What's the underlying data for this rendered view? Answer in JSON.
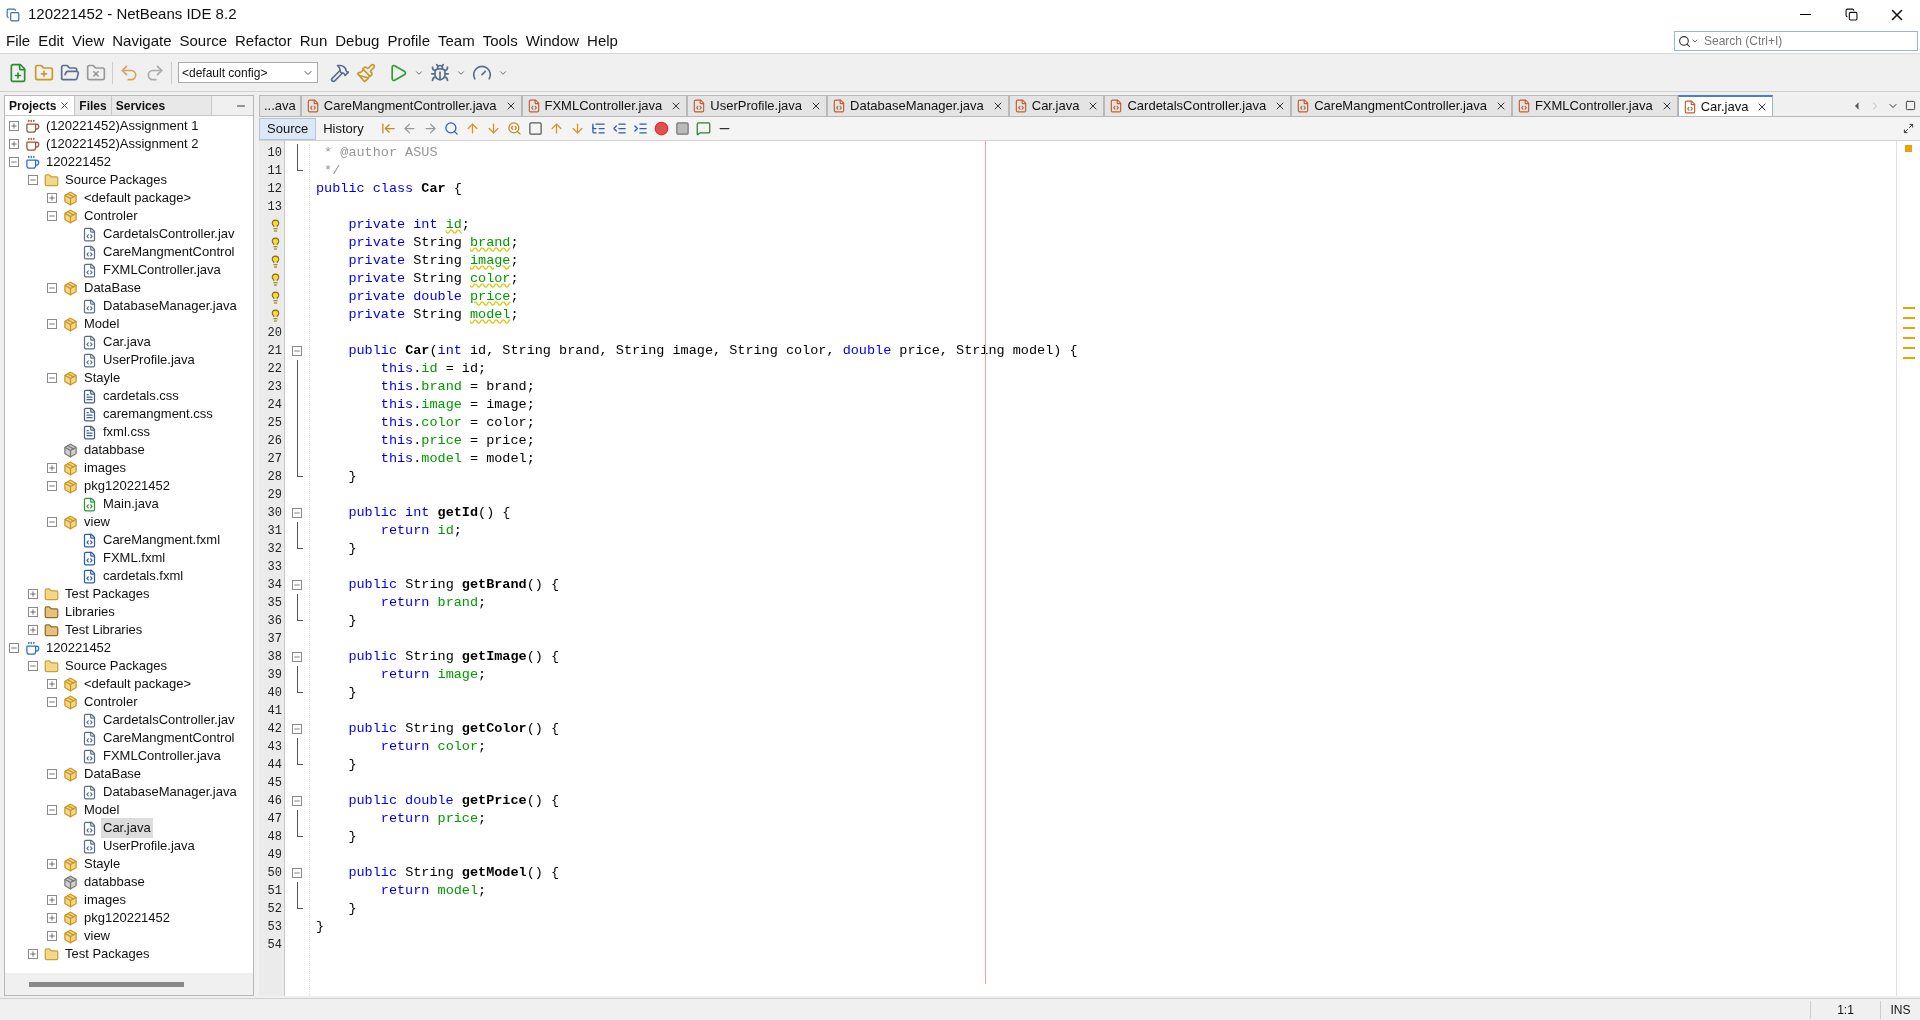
{
  "window": {
    "title": "120221452 - NetBeans IDE 8.2"
  },
  "menu": [
    "File",
    "Edit",
    "View",
    "Navigate",
    "Source",
    "Refactor",
    "Run",
    "Debug",
    "Profile",
    "Team",
    "Tools",
    "Window",
    "Help"
  ],
  "search": {
    "placeholder": "Search (Ctrl+I)"
  },
  "toolbar": {
    "config": "<default config>"
  },
  "side_panel": {
    "tabs": [
      {
        "label": "Projects",
        "selected": true
      },
      {
        "label": "Files",
        "selected": false
      },
      {
        "label": "Services",
        "selected": false
      }
    ],
    "tree": [
      {
        "label": "(120221452)Assignment 1",
        "kind": "project",
        "expanded": false,
        "selected": false
      },
      {
        "label": "(120221452)Assignment 2",
        "kind": "project",
        "expanded": false,
        "selected": false
      },
      {
        "label": "120221452",
        "kind": "fx-project",
        "expanded": true,
        "selected": false,
        "children": [
          {
            "label": "Source Packages",
            "kind": "source-folder",
            "expanded": true,
            "selected": false,
            "children": [
              {
                "label": "<default package>",
                "kind": "package",
                "expanded": false,
                "selected": false
              },
              {
                "label": "Controler",
                "kind": "package",
                "expanded": true,
                "selected": false,
                "children": [
                  {
                    "label": "CardetalsController.jav",
                    "kind": "java",
                    "selected": false
                  },
                  {
                    "label": "CareMangmentControl",
                    "kind": "java",
                    "selected": false
                  },
                  {
                    "label": "FXMLController.java",
                    "kind": "java",
                    "selected": false
                  }
                ]
              },
              {
                "label": "DataBase",
                "kind": "package",
                "expanded": true,
                "selected": false,
                "children": [
                  {
                    "label": "DatabaseManager.java",
                    "kind": "java",
                    "selected": false
                  }
                ]
              },
              {
                "label": "Model",
                "kind": "package",
                "expanded": true,
                "selected": false,
                "children": [
                  {
                    "label": "Car.java",
                    "kind": "java",
                    "selected": false
                  },
                  {
                    "label": "UserProfile.java",
                    "kind": "java",
                    "selected": false
                  }
                ]
              },
              {
                "label": "Stayle",
                "kind": "package",
                "expanded": true,
                "selected": false,
                "children": [
                  {
                    "label": "cardetals.css",
                    "kind": "css",
                    "selected": false
                  },
                  {
                    "label": "caremangment.css",
                    "kind": "css",
                    "selected": false
                  },
                  {
                    "label": "fxml.css",
                    "kind": "css",
                    "selected": false
                  }
                ]
              },
              {
                "label": "databbase",
                "kind": "empty-package",
                "selected": false
              },
              {
                "label": "images",
                "kind": "package",
                "expanded": false,
                "selected": false
              },
              {
                "label": "pkg120221452",
                "kind": "package",
                "expanded": true,
                "selected": false,
                "children": [
                  {
                    "label": "Main.java",
                    "kind": "main-java",
                    "selected": false
                  }
                ]
              },
              {
                "label": "view",
                "kind": "package",
                "expanded": true,
                "selected": false,
                "children": [
                  {
                    "label": "CareMangment.fxml",
                    "kind": "fxml",
                    "selected": false
                  },
                  {
                    "label": "FXML.fxml",
                    "kind": "fxml",
                    "selected": false
                  },
                  {
                    "label": "cardetals.fxml",
                    "kind": "fxml",
                    "selected": false
                  }
                ]
              }
            ]
          },
          {
            "label": "Test Packages",
            "kind": "source-folder",
            "expanded": false,
            "selected": false
          },
          {
            "label": "Libraries",
            "kind": "library-folder",
            "expanded": false,
            "selected": false
          },
          {
            "label": "Test Libraries",
            "kind": "library-folder",
            "expanded": false,
            "selected": false
          }
        ]
      },
      {
        "label": "120221452",
        "kind": "fx-project",
        "expanded": true,
        "selected": false,
        "children": [
          {
            "label": "Source Packages",
            "kind": "source-folder",
            "expanded": true,
            "selected": false,
            "children": [
              {
                "label": "<default package>",
                "kind": "package",
                "expanded": false,
                "selected": false
              },
              {
                "label": "Controler",
                "kind": "package",
                "expanded": true,
                "selected": false,
                "children": [
                  {
                    "label": "CardetalsController.jav",
                    "kind": "java",
                    "selected": false
                  },
                  {
                    "label": "CareMangmentControl",
                    "kind": "java",
                    "selected": false
                  },
                  {
                    "label": "FXMLController.java",
                    "kind": "java",
                    "selected": false
                  }
                ]
              },
              {
                "label": "DataBase",
                "kind": "package",
                "expanded": true,
                "selected": false,
                "children": [
                  {
                    "label": "DatabaseManager.java",
                    "kind": "java",
                    "selected": false
                  }
                ]
              },
              {
                "label": "Model",
                "kind": "package",
                "expanded": true,
                "selected": false,
                "children": [
                  {
                    "label": "Car.java",
                    "kind": "java",
                    "selected": true
                  },
                  {
                    "label": "UserProfile.java",
                    "kind": "java",
                    "selected": false
                  }
                ]
              },
              {
                "label": "Stayle",
                "kind": "package",
                "expanded": false,
                "selected": false
              },
              {
                "label": "databbase",
                "kind": "empty-package",
                "selected": false
              },
              {
                "label": "images",
                "kind": "package",
                "expanded": false,
                "selected": false
              },
              {
                "label": "pkg120221452",
                "kind": "package",
                "expanded": false,
                "selected": false
              },
              {
                "label": "view",
                "kind": "package",
                "expanded": false,
                "selected": false
              }
            ]
          },
          {
            "label": "Test Packages",
            "kind": "source-folder",
            "expanded": false,
            "selected": false
          }
        ]
      }
    ]
  },
  "editor": {
    "tabs": [
      {
        "label": "...ava",
        "selected": false
      },
      {
        "label": "CareMangmentController.java",
        "selected": false
      },
      {
        "label": "FXMLController.java",
        "selected": false
      },
      {
        "label": "UserProfile.java",
        "selected": false
      },
      {
        "label": "DatabaseManager.java",
        "selected": false
      },
      {
        "label": "Car.java",
        "selected": false
      },
      {
        "label": "CardetalsController.java",
        "selected": false
      },
      {
        "label": "CareMangmentController.java",
        "selected": false
      },
      {
        "label": "FXMLController.java",
        "selected": false
      },
      {
        "label": "Car.java",
        "selected": true
      }
    ],
    "views": [
      {
        "label": "Source",
        "selected": true
      },
      {
        "label": "History",
        "selected": false
      }
    ],
    "lines": [
      {
        "number": "10",
        "kind": "fold-body",
        "tokens": [
          {
            "kind": "comment",
            "text": " * @author ASUS"
          }
        ]
      },
      {
        "number": "11",
        "kind": "fold-end",
        "tokens": [
          {
            "kind": "comment",
            "text": " */"
          }
        ]
      },
      {
        "number": "12",
        "kind": "plain",
        "tokens": [
          {
            "kind": "keyword",
            "text": "public class "
          },
          {
            "kind": "name",
            "text": "Car"
          },
          {
            "kind": "plain",
            "text": " {"
          }
        ]
      },
      {
        "number": "13",
        "kind": "plain"
      },
      {
        "kind": "warning",
        "tokens": [
          {
            "kind": "keyword",
            "text": "    private int "
          },
          {
            "kind": "unused-field",
            "text": "id"
          },
          {
            "kind": "plain",
            "text": ";"
          }
        ]
      },
      {
        "kind": "warning",
        "tokens": [
          {
            "kind": "keyword",
            "text": "    private "
          },
          {
            "kind": "plain",
            "text": "String "
          },
          {
            "kind": "unused-field",
            "text": "brand"
          },
          {
            "kind": "plain",
            "text": ";"
          }
        ]
      },
      {
        "kind": "warning",
        "tokens": [
          {
            "kind": "keyword",
            "text": "    private "
          },
          {
            "kind": "plain",
            "text": "String "
          },
          {
            "kind": "unused-field",
            "text": "image"
          },
          {
            "kind": "plain",
            "text": ";"
          }
        ]
      },
      {
        "kind": "warning",
        "tokens": [
          {
            "kind": "keyword",
            "text": "    private "
          },
          {
            "kind": "plain",
            "text": "String "
          },
          {
            "kind": "unused-field",
            "text": "color"
          },
          {
            "kind": "plain",
            "text": ";"
          }
        ]
      },
      {
        "kind": "warning",
        "tokens": [
          {
            "kind": "keyword",
            "text": "    private double "
          },
          {
            "kind": "unused-field",
            "text": "price"
          },
          {
            "kind": "plain",
            "text": ";"
          }
        ]
      },
      {
        "kind": "warning",
        "tokens": [
          {
            "kind": "keyword",
            "text": "    private "
          },
          {
            "kind": "plain",
            "text": "String "
          },
          {
            "kind": "unused-field",
            "text": "model"
          },
          {
            "kind": "plain",
            "text": ";"
          }
        ]
      },
      {
        "number": "20",
        "kind": "plain"
      },
      {
        "number": "21",
        "kind": "fold-start",
        "tokens": [
          {
            "kind": "keyword",
            "text": "    public "
          },
          {
            "kind": "name",
            "text": "Car"
          },
          {
            "kind": "plain",
            "text": "("
          },
          {
            "kind": "keyword",
            "text": "int"
          },
          {
            "kind": "plain",
            "text": " id, String brand, String image, String color, "
          },
          {
            "kind": "keyword",
            "text": "double"
          },
          {
            "kind": "plain",
            "text": " price, String model) {"
          }
        ]
      },
      {
        "number": "22",
        "kind": "fold-body",
        "tokens": [
          {
            "kind": "keyword",
            "text": "        this"
          },
          {
            "kind": "plain",
            "text": "."
          },
          {
            "kind": "field",
            "text": "id"
          },
          {
            "kind": "plain",
            "text": " = id;"
          }
        ]
      },
      {
        "number": "23",
        "kind": "fold-body",
        "tokens": [
          {
            "kind": "keyword",
            "text": "        this"
          },
          {
            "kind": "plain",
            "text": "."
          },
          {
            "kind": "field",
            "text": "brand"
          },
          {
            "kind": "plain",
            "text": " = brand;"
          }
        ]
      },
      {
        "number": "24",
        "kind": "fold-body",
        "tokens": [
          {
            "kind": "keyword",
            "text": "        this"
          },
          {
            "kind": "plain",
            "text": "."
          },
          {
            "kind": "field",
            "text": "image"
          },
          {
            "kind": "plain",
            "text": " = image;"
          }
        ]
      },
      {
        "number": "25",
        "kind": "fold-body",
        "tokens": [
          {
            "kind": "keyword",
            "text": "        this"
          },
          {
            "kind": "plain",
            "text": "."
          },
          {
            "kind": "field",
            "text": "color"
          },
          {
            "kind": "plain",
            "text": " = color;"
          }
        ]
      },
      {
        "number": "26",
        "kind": "fold-body",
        "tokens": [
          {
            "kind": "keyword",
            "text": "        this"
          },
          {
            "kind": "plain",
            "text": "."
          },
          {
            "kind": "field",
            "text": "price"
          },
          {
            "kind": "plain",
            "text": " = price;"
          }
        ]
      },
      {
        "number": "27",
        "kind": "fold-body",
        "tokens": [
          {
            "kind": "keyword",
            "text": "        this"
          },
          {
            "kind": "plain",
            "text": "."
          },
          {
            "kind": "field",
            "text": "model"
          },
          {
            "kind": "plain",
            "text": " = model;"
          }
        ]
      },
      {
        "number": "28",
        "kind": "fold-end",
        "tokens": [
          {
            "kind": "plain",
            "text": "    }"
          }
        ]
      },
      {
        "number": "29",
        "kind": "plain"
      },
      {
        "number": "30",
        "kind": "fold-start",
        "tokens": [
          {
            "kind": "keyword",
            "text": "    public int "
          },
          {
            "kind": "name",
            "text": "getId"
          },
          {
            "kind": "plain",
            "text": "() {"
          }
        ]
      },
      {
        "number": "31",
        "kind": "fold-body",
        "tokens": [
          {
            "kind": "keyword",
            "text": "        return "
          },
          {
            "kind": "field",
            "text": "id"
          },
          {
            "kind": "plain",
            "text": ";"
          }
        ]
      },
      {
        "number": "32",
        "kind": "fold-end",
        "tokens": [
          {
            "kind": "plain",
            "text": "    }"
          }
        ]
      },
      {
        "number": "33",
        "kind": "plain"
      },
      {
        "number": "34",
        "kind": "fold-start",
        "tokens": [
          {
            "kind": "keyword",
            "text": "    public "
          },
          {
            "kind": "plain",
            "text": "String "
          },
          {
            "kind": "name",
            "text": "getBrand"
          },
          {
            "kind": "plain",
            "text": "() {"
          }
        ]
      },
      {
        "number": "35",
        "kind": "fold-body",
        "tokens": [
          {
            "kind": "keyword",
            "text": "        return "
          },
          {
            "kind": "field",
            "text": "brand"
          },
          {
            "kind": "plain",
            "text": ";"
          }
        ]
      },
      {
        "number": "36",
        "kind": "fold-end",
        "tokens": [
          {
            "kind": "plain",
            "text": "    }"
          }
        ]
      },
      {
        "number": "37",
        "kind": "plain"
      },
      {
        "number": "38",
        "kind": "fold-start",
        "tokens": [
          {
            "kind": "keyword",
            "text": "    public "
          },
          {
            "kind": "plain",
            "text": "String "
          },
          {
            "kind": "name",
            "text": "getImage"
          },
          {
            "kind": "plain",
            "text": "() {"
          }
        ]
      },
      {
        "number": "39",
        "kind": "fold-body",
        "tokens": [
          {
            "kind": "keyword",
            "text": "        return "
          },
          {
            "kind": "field",
            "text": "image"
          },
          {
            "kind": "plain",
            "text": ";"
          }
        ]
      },
      {
        "number": "40",
        "kind": "fold-end",
        "tokens": [
          {
            "kind": "plain",
            "text": "    }"
          }
        ]
      },
      {
        "number": "41",
        "kind": "plain"
      },
      {
        "number": "42",
        "kind": "fold-start",
        "tokens": [
          {
            "kind": "keyword",
            "text": "    public "
          },
          {
            "kind": "plain",
            "text": "String "
          },
          {
            "kind": "name",
            "text": "getColor"
          },
          {
            "kind": "plain",
            "text": "() {"
          }
        ]
      },
      {
        "number": "43",
        "kind": "fold-body",
        "tokens": [
          {
            "kind": "keyword",
            "text": "        return "
          },
          {
            "kind": "field",
            "text": "color"
          },
          {
            "kind": "plain",
            "text": ";"
          }
        ]
      },
      {
        "number": "44",
        "kind": "fold-end",
        "tokens": [
          {
            "kind": "plain",
            "text": "    }"
          }
        ]
      },
      {
        "number": "45",
        "kind": "plain"
      },
      {
        "number": "46",
        "kind": "fold-start",
        "tokens": [
          {
            "kind": "keyword",
            "text": "    public double "
          },
          {
            "kind": "name",
            "text": "getPrice"
          },
          {
            "kind": "plain",
            "text": "() {"
          }
        ]
      },
      {
        "number": "47",
        "kind": "fold-body",
        "tokens": [
          {
            "kind": "keyword",
            "text": "        return "
          },
          {
            "kind": "field",
            "text": "price"
          },
          {
            "kind": "plain",
            "text": ";"
          }
        ]
      },
      {
        "number": "48",
        "kind": "fold-end",
        "tokens": [
          {
            "kind": "plain",
            "text": "    }"
          }
        ]
      },
      {
        "number": "49",
        "kind": "plain"
      },
      {
        "number": "50",
        "kind": "fold-start",
        "tokens": [
          {
            "kind": "keyword",
            "text": "    public "
          },
          {
            "kind": "plain",
            "text": "String "
          },
          {
            "kind": "name",
            "text": "getModel"
          },
          {
            "kind": "plain",
            "text": "() {"
          }
        ]
      },
      {
        "number": "51",
        "kind": "fold-body",
        "tokens": [
          {
            "kind": "keyword",
            "text": "        return "
          },
          {
            "kind": "field",
            "text": "model"
          },
          {
            "kind": "plain",
            "text": ";"
          }
        ]
      },
      {
        "number": "52",
        "kind": "fold-end",
        "tokens": [
          {
            "kind": "plain",
            "text": "    }"
          }
        ]
      },
      {
        "number": "53",
        "kind": "plain",
        "tokens": [
          {
            "kind": "plain",
            "text": "}"
          }
        ]
      },
      {
        "number": "54",
        "kind": "plain"
      }
    ]
  },
  "status_bar": {
    "position": "1:1",
    "mode": "INS"
  }
}
